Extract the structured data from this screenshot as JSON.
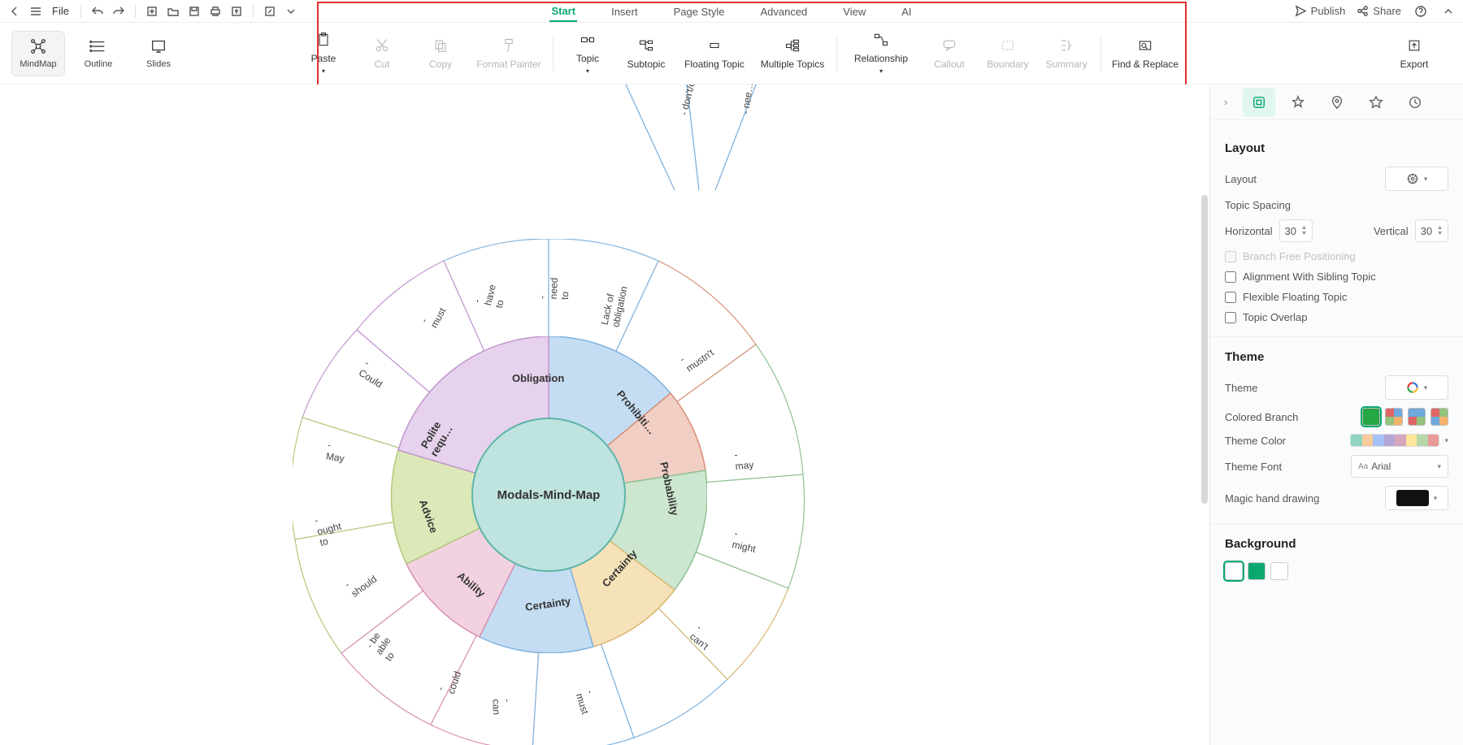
{
  "topbar": {
    "file": "File",
    "publish": "Publish",
    "share": "Share"
  },
  "menu": {
    "start": "Start",
    "insert": "Insert",
    "page_style": "Page Style",
    "advanced": "Advanced",
    "view": "View",
    "ai": "AI"
  },
  "view_modes": {
    "mindmap": "MindMap",
    "outline": "Outline",
    "slides": "Slides"
  },
  "ribbon": {
    "paste": "Paste",
    "cut": "Cut",
    "copy": "Copy",
    "format_painter": "Format Painter",
    "topic": "Topic",
    "subtopic": "Subtopic",
    "floating_topic": "Floating Topic",
    "multiple_topics": "Multiple Topics",
    "relationship": "Relationship",
    "callout": "Callout",
    "boundary": "Boundary",
    "summary": "Summary",
    "find_replace": "Find & Replace",
    "export": "Export"
  },
  "panel": {
    "layout_title": "Layout",
    "layout_label": "Layout",
    "spacing_label": "Topic Spacing",
    "horizontal": "Horizontal",
    "vertical": "Vertical",
    "h_val": "30",
    "v_val": "30",
    "branch_free": "Branch Free Positioning",
    "align_sibling": "Alignment With Sibling Topic",
    "flex_floating": "Flexible Floating Topic",
    "topic_overlap": "Topic Overlap",
    "theme_title": "Theme",
    "theme_label": "Theme",
    "colored_branch": "Colored Branch",
    "theme_color": "Theme Color",
    "theme_font": "Theme Font",
    "font_value": "Arial",
    "magic_hand": "Magic hand drawing",
    "background_title": "Background"
  },
  "mindmap": {
    "center": "Modals-Mind-Map",
    "ring1": {
      "obligation": "Obligation",
      "prohibition": "Prohibiti…",
      "probability": "Probability",
      "certainty": "Certainty",
      "certainty2": "Certainty",
      "ability": "Ability",
      "advice": "Advice",
      "polite": "Polite requ…"
    },
    "ring2": {
      "must": "- must",
      "have_to": "- have to",
      "need_to": "- need to",
      "lack_oblig": "Lack of obligation",
      "mustnt": "- mustn't",
      "may": "- may",
      "might": "- might",
      "cant": "- can't",
      "must2": "- must",
      "can": "- can",
      "could": "- could",
      "be_able": "- be able to",
      "should": "- should",
      "ought": "- ought to",
      "may2": "- May",
      "could2": "- Could"
    },
    "stray": {
      "dont": "- don't/d…",
      "need": "- nee…"
    }
  },
  "colors": {
    "obligation": "#c5ddf2",
    "prohibition": "#f2cfc4",
    "probability": "#cde6cf",
    "certainty": "#f6e2b8",
    "certainty2": "#c5ddf2",
    "ability": "#f2d2e0",
    "advice": "#dce8b8",
    "polite": "#e6d2ec",
    "obligation_b": "#7fb2dd",
    "prohibition_b": "#d98f76",
    "probability_b": "#8fc294",
    "certainty_b": "#d9b670",
    "certainty2_b": "#7fb2dd",
    "ability_b": "#d98fb2",
    "advice_b": "#b3c97a",
    "polite_b": "#c296ce"
  }
}
